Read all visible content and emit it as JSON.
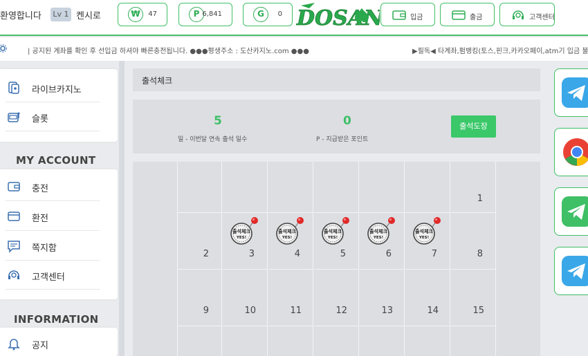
{
  "header": {
    "welcome": "환영합니다",
    "level": "Lv 1",
    "username": "켄시로",
    "balances": [
      {
        "icon": "won-icon",
        "symbol": "₩",
        "value": "47"
      },
      {
        "icon": "point-icon",
        "symbol": "P",
        "value": "6,841"
      },
      {
        "icon": "gold-icon",
        "symbol": "G",
        "value": "0"
      }
    ],
    "logo_text": "DOSAN",
    "buttons": [
      {
        "label": "입금",
        "icon": "wallet-icon"
      },
      {
        "label": "출금",
        "icon": "card-icon"
      },
      {
        "label": "고객센터",
        "icon": "headset-icon"
      }
    ]
  },
  "notice": {
    "text": "| 공지된 계좌를 확인 후 선입금 하셔야 빠른충전됩니다. ●●●평생주소 : 도산카지노.com ●●●",
    "text2": "▶필독◀ 타계좌,펌뱅킹(토스,핀크,카카오페이,atm기 입금 불가"
  },
  "sidebar": {
    "games": [
      {
        "label": "라이브카지노",
        "icon": "casino-cards-icon"
      },
      {
        "label": "슬롯",
        "icon": "slot-machine-icon"
      }
    ],
    "account_title": "MY ACCOUNT",
    "account": [
      {
        "label": "충전",
        "icon": "wallet-icon"
      },
      {
        "label": "환전",
        "icon": "card-icon"
      },
      {
        "label": "쪽지함",
        "icon": "message-icon"
      },
      {
        "label": "고객센터",
        "icon": "headset-icon"
      }
    ],
    "info_title": "INFORMATION",
    "info": [
      {
        "label": "공지",
        "icon": "bell-icon"
      }
    ]
  },
  "main": {
    "title": "출석체크",
    "days_value": "5",
    "days_label": "일 - 이번달 연속 출석 일수",
    "points_value": "0",
    "points_label": "P - 지급받은 포인트",
    "check_button": "출석도장",
    "stamp_text": "출석체크",
    "stamp_sub": "YES!",
    "calendar": {
      "rows": [
        [
          "",
          "",
          "",
          "",
          "",
          "",
          "1"
        ],
        [
          "2",
          "3",
          "4",
          "5",
          "6",
          "7",
          "8"
        ],
        [
          "9",
          "10",
          "11",
          "12",
          "13",
          "14",
          "15"
        ],
        [
          "",
          "",
          "",
          "",
          "",
          "",
          ""
        ]
      ],
      "stamped_days": [
        "3",
        "4",
        "5",
        "6",
        "7"
      ]
    }
  },
  "right_rail": [
    {
      "icon": "telegram-icon",
      "color": "#3aa7e8"
    },
    {
      "icon": "chrome-icon",
      "color": "#e94235"
    },
    {
      "icon": "message-app-icon",
      "color": "#3fbf66"
    },
    {
      "icon": "telegram-icon",
      "color": "#3aa7e8"
    }
  ],
  "colors": {
    "accent": "#3fbf66",
    "panel": "#dcdee2",
    "background": "#e9ebee"
  }
}
